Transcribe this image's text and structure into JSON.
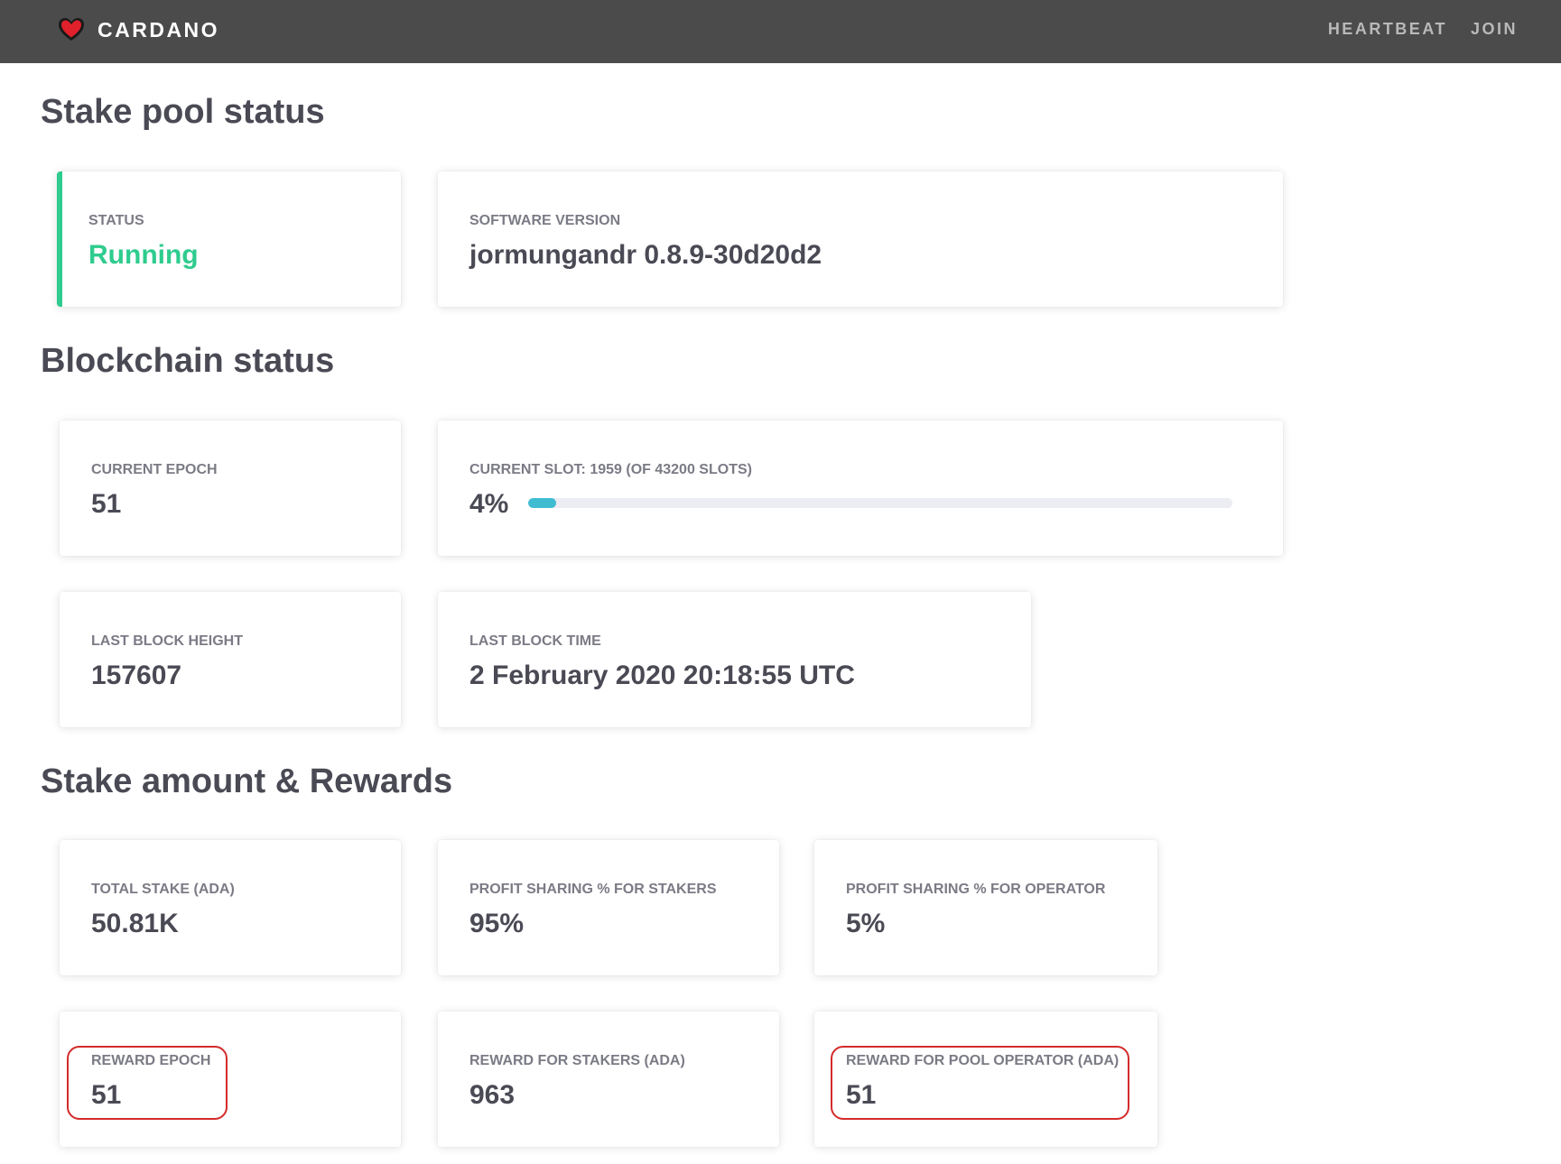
{
  "header": {
    "brand": "CARDANO",
    "brand_icon": "heart-icon",
    "brand_icon_color": "#e0202a",
    "nav": [
      {
        "label": "HEARTBEAT"
      },
      {
        "label": "JOIN"
      }
    ]
  },
  "stake_pool": {
    "title": "Stake pool status",
    "status": {
      "label": "STATUS",
      "value": "Running",
      "color": "#2ecc8e"
    },
    "software": {
      "label": "SOFTWARE VERSION",
      "value": "jormungandr 0.8.9-30d20d2"
    }
  },
  "blockchain": {
    "title": "Blockchain status",
    "epoch": {
      "label": "CURRENT EPOCH",
      "value": "51"
    },
    "slot": {
      "label": "CURRENT SLOT: 1959 (OF 43200 SLOTS)",
      "value": "4%",
      "progress_percent": 4,
      "bar_color": "#3fbcd2"
    },
    "block_height": {
      "label": "LAST BLOCK HEIGHT",
      "value": "157607"
    },
    "block_time": {
      "label": "LAST BLOCK TIME",
      "value": "2 February 2020 20:18:55 UTC"
    }
  },
  "rewards": {
    "title": "Stake amount & Rewards",
    "total_stake": {
      "label": "TOTAL STAKE (ADA)",
      "value": "50.81K"
    },
    "share_stakers": {
      "label": "PROFIT SHARING % FOR STAKERS",
      "value": "95%"
    },
    "share_operator": {
      "label": "PROFIT SHARING % FOR OPERATOR",
      "value": "5%"
    },
    "reward_epoch": {
      "label": "REWARD EPOCH",
      "value": "51"
    },
    "reward_stakers": {
      "label": "REWARD FOR STAKERS (ADA)",
      "value": "963"
    },
    "reward_operator": {
      "label": "REWARD FOR POOL OPERATOR (ADA)",
      "value": "51"
    }
  },
  "annotation_color": "#d42b2b"
}
